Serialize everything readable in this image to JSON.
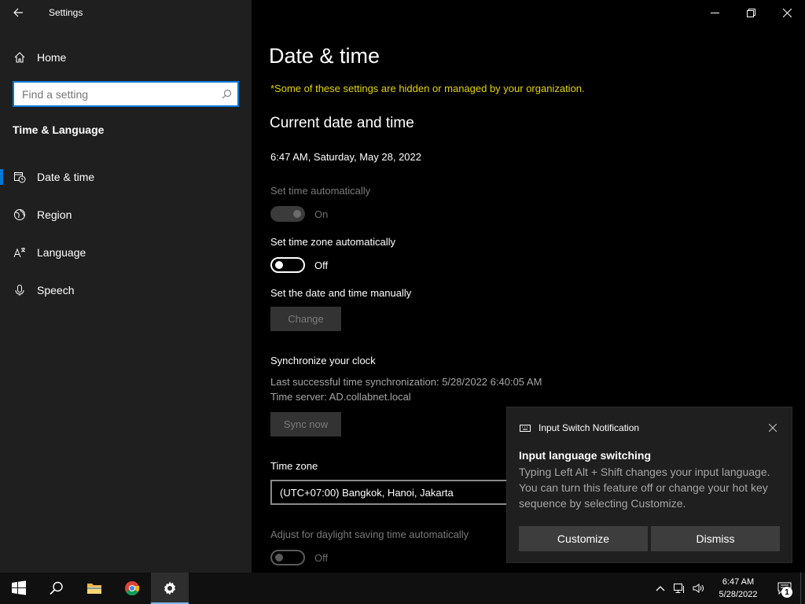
{
  "app": {
    "title": "Settings"
  },
  "sidebar": {
    "home_label": "Home",
    "search_placeholder": "Find a setting",
    "section": "Time & Language",
    "items": [
      {
        "label": "Date & time",
        "icon": "date-time-icon",
        "active": true
      },
      {
        "label": "Region",
        "icon": "globe-icon"
      },
      {
        "label": "Language",
        "icon": "language-icon"
      },
      {
        "label": "Speech",
        "icon": "microphone-icon"
      }
    ]
  },
  "main": {
    "title": "Date & time",
    "org_note": "*Some of these settings are hidden or managed by your organization.",
    "current_header": "Current date and time",
    "current_datetime": "6:47 AM, Saturday, May 28, 2022",
    "set_time_auto": {
      "label": "Set time automatically",
      "state": "On"
    },
    "set_tz_auto": {
      "label": "Set time zone automatically",
      "state": "Off"
    },
    "manual": {
      "label": "Set the date and time manually",
      "button": "Change"
    },
    "sync": {
      "header": "Synchronize your clock",
      "last_sync": "Last successful time synchronization: 5/28/2022 6:40:05 AM",
      "server": "Time server: AD.collabnet.local",
      "button": "Sync now"
    },
    "timezone": {
      "label": "Time zone",
      "value": "(UTC+07:00) Bangkok, Hanoi, Jakarta"
    },
    "dst": {
      "label": "Adjust for daylight saving time automatically",
      "state": "Off"
    }
  },
  "notification": {
    "app": "Input Switch Notification",
    "title": "Input language switching",
    "body": "Typing Left Alt + Shift changes your input language. You can turn this feature off or change your hot key sequence by selecting Customize.",
    "customize": "Customize",
    "dismiss": "Dismiss"
  },
  "taskbar": {
    "time": "6:47 AM",
    "date": "5/28/2022",
    "notification_count": "1"
  },
  "colors": {
    "accent": "#0078d7",
    "warning_text": "#e6d400"
  }
}
